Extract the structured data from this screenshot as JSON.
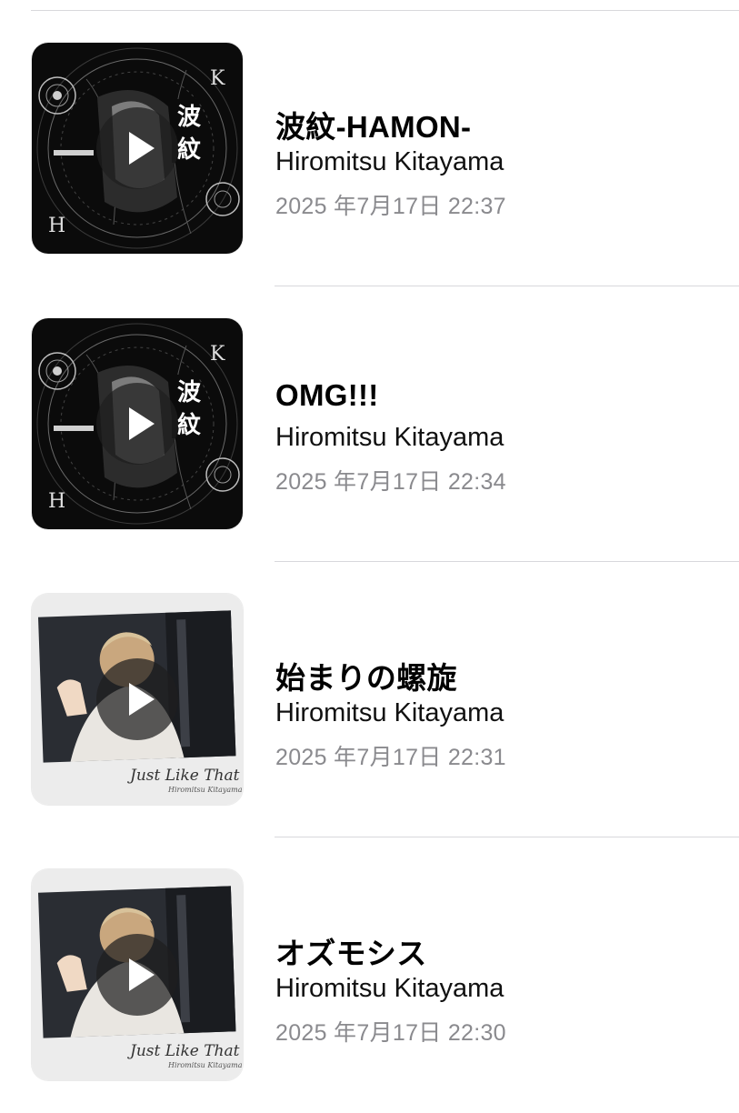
{
  "colors": {
    "divider": "#d8d8dc",
    "title": "#000000",
    "artist": "#111111",
    "date": "#8a8a8e",
    "play_button_bg": "#1e1e1e"
  },
  "tracks": [
    {
      "title": "波紋-HAMON-",
      "artist": "Hiromitsu Kitayama",
      "date": "2025 年7月17日 22:37",
      "artwork": "hamon-dark-cover",
      "play_icon": "play-icon"
    },
    {
      "title": "OMG!!!",
      "artist": "Hiromitsu Kitayama",
      "date": "2025 年7月17日 22:34",
      "artwork": "hamon-dark-cover",
      "play_icon": "play-icon"
    },
    {
      "title": "始まりの螺旋",
      "artist": "Hiromitsu Kitayama",
      "date": "2025 年7月17日 22:31",
      "artwork": "just-like-that-polaroid-cover",
      "play_icon": "play-icon"
    },
    {
      "title": "オズモシス",
      "artist": "Hiromitsu Kitayama",
      "date": "2025 年7月17日 22:30",
      "artwork": "just-like-that-polaroid-cover",
      "play_icon": "play-icon"
    }
  ]
}
